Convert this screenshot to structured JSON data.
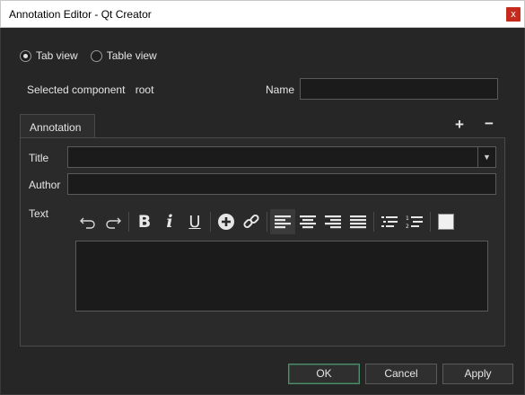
{
  "window": {
    "title": "Annotation Editor - Qt Creator",
    "close_glyph": "x"
  },
  "view_mode": {
    "options": [
      {
        "label": "Tab view",
        "checked": true
      },
      {
        "label": "Table view",
        "checked": false
      }
    ]
  },
  "component": {
    "selected_label": "Selected component",
    "selected_value": "root",
    "name_label": "Name",
    "name_value": ""
  },
  "tabs": {
    "items": [
      {
        "label": "Annotation"
      }
    ],
    "add_glyph": "+",
    "remove_glyph": "−"
  },
  "form": {
    "title_label": "Title",
    "title_value": "",
    "author_label": "Author",
    "author_value": "",
    "text_label": "Text",
    "text_value": ""
  },
  "toolbar": {
    "icons": [
      "undo-icon",
      "redo-icon",
      "bold-icon",
      "italic-icon",
      "underline-icon",
      "add-icon",
      "link-icon",
      "align-left-icon",
      "align-center-icon",
      "align-right-icon",
      "justify-icon",
      "bullet-list-icon",
      "numbered-list-icon",
      "color-swatch-icon"
    ],
    "active_alignment": "align-left",
    "swatch_color": "#f0f0f0"
  },
  "buttons": {
    "ok": "OK",
    "cancel": "Cancel",
    "apply": "Apply"
  },
  "colors": {
    "background": "#262626",
    "input_bg": "#1b1b1b",
    "ok_border": "#4f8d6d",
    "close_button": "#c42b1c"
  }
}
